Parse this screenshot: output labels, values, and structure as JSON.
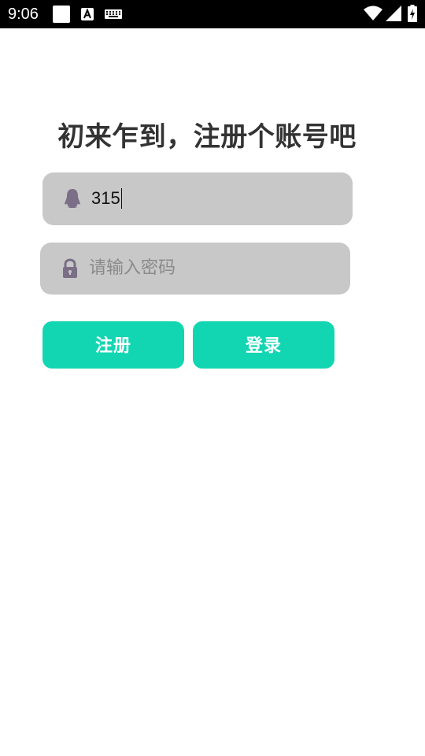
{
  "status_bar": {
    "time": "9:06",
    "icons": [
      "square-notification-icon",
      "a-notification-icon",
      "keyboard-icon",
      "wifi-icon",
      "signal-icon",
      "battery-charging-icon"
    ]
  },
  "title": "初来乍到，注册个账号吧",
  "username_field": {
    "icon": "qq-penguin-icon",
    "value": "315"
  },
  "password_field": {
    "icon": "lock-icon",
    "placeholder": "请输入密码"
  },
  "buttons": {
    "register_label": "注册",
    "login_label": "登录"
  },
  "colors": {
    "accent": "#12d6b2",
    "field_bg": "#c8c8c8",
    "icon": "#7a6f86",
    "title": "#333333"
  }
}
